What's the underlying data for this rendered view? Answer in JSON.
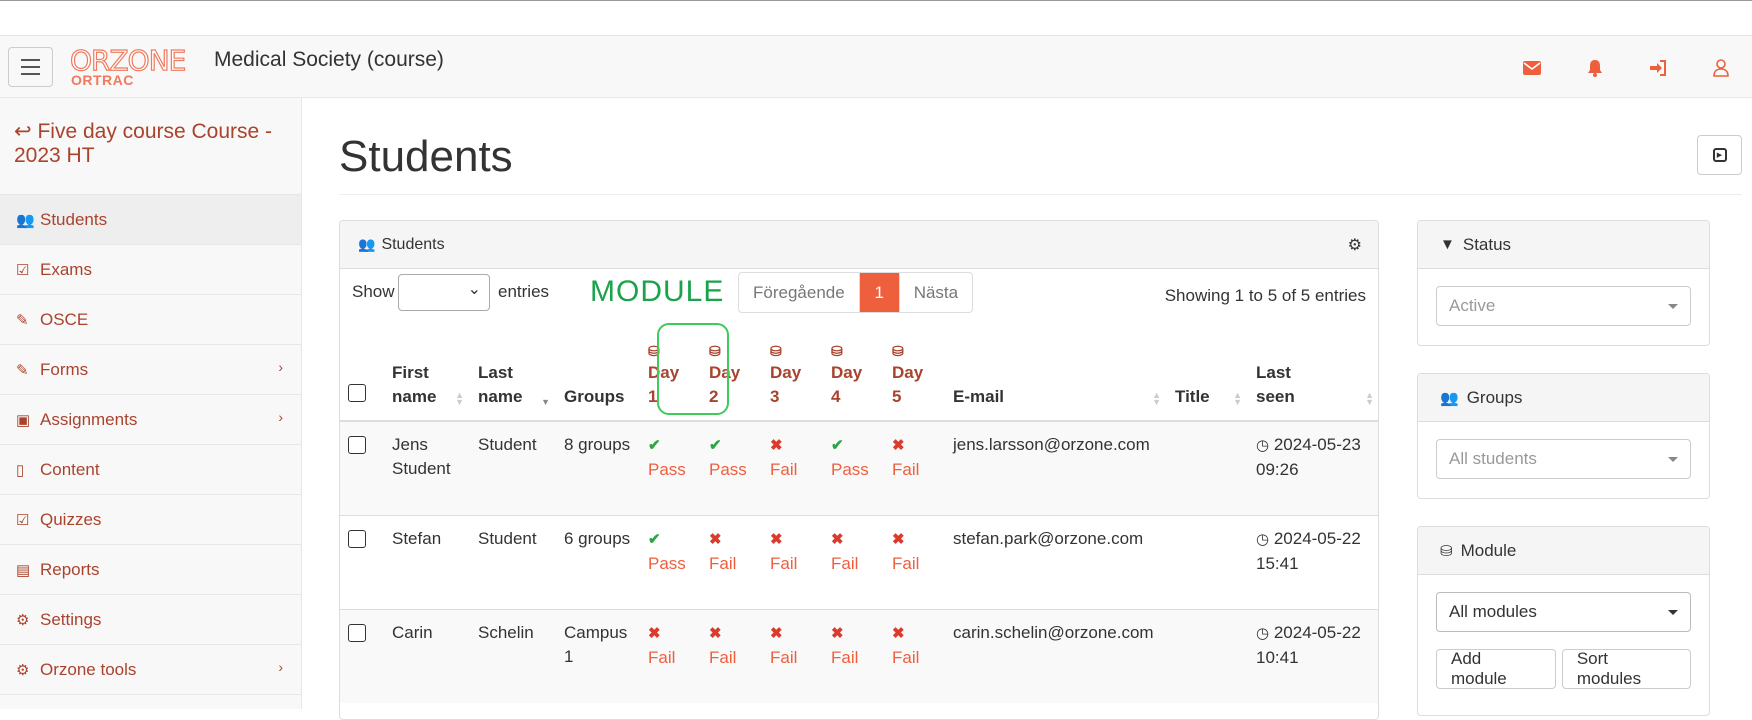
{
  "navbar": {
    "logo_top": "ORZONE",
    "logo_bottom": "ORTRAC",
    "course_title": "Medical Society (course)",
    "icons": [
      "envelope-icon",
      "bell-icon",
      "sign-in-icon",
      "user-icon"
    ]
  },
  "sidebar": {
    "back_label": "Five day course Course - 2023 HT",
    "items": [
      {
        "label": "Students",
        "icon": "users-icon",
        "active": true
      },
      {
        "label": "Exams",
        "icon": "check-square-icon"
      },
      {
        "label": "OSCE",
        "icon": "edit-icon"
      },
      {
        "label": "Forms",
        "icon": "edit-icon",
        "submenu": true
      },
      {
        "label": "Assignments",
        "icon": "word-file-icon",
        "submenu": true
      },
      {
        "label": "Content",
        "icon": "file-icon"
      },
      {
        "label": "Quizzes",
        "icon": "check-square-icon"
      },
      {
        "label": "Reports",
        "icon": "pdf-file-icon"
      },
      {
        "label": "Settings",
        "icon": "cogs-icon"
      },
      {
        "label": "Orzone tools",
        "icon": "cogs-icon",
        "submenu": true
      }
    ]
  },
  "main": {
    "page_title": "Students",
    "panel_title": "Students",
    "show_label": "Show",
    "entries_label": "entries",
    "module_annotation": "MODULE",
    "pager": {
      "prev": "Föregående",
      "current": "1",
      "next": "Nästa"
    },
    "showing_text": "Showing 1 to 5 of 5 entries",
    "columns": {
      "first_name": "First name",
      "last_name": "Last name",
      "groups": "Groups",
      "day1": "Day 1",
      "day2": "Day 2",
      "day3": "Day 3",
      "day4": "Day 4",
      "day5": "Day 5",
      "email": "E-mail",
      "title": "Title",
      "last_seen": "Last seen"
    },
    "rows": [
      {
        "first": "Jens Student",
        "last": "Student",
        "groups": "8 groups",
        "days": [
          "Pass",
          "Pass",
          "Fail",
          "Pass",
          "Fail"
        ],
        "email": "jens.larsson@orzone.com",
        "title": "",
        "last_seen": "2024-05-23 09:26"
      },
      {
        "first": "Stefan",
        "last": "Student",
        "groups": "6 groups",
        "days": [
          "Pass",
          "Fail",
          "Fail",
          "Fail",
          "Fail"
        ],
        "email": "stefan.park@orzone.com",
        "title": "",
        "last_seen": "2024-05-22 15:41"
      },
      {
        "first": "Carin",
        "last": "Schelin",
        "groups": "Campus 1",
        "days": [
          "Fail",
          "Fail",
          "Fail",
          "Fail",
          "Fail"
        ],
        "email": "carin.schelin@orzone.com",
        "title": "",
        "last_seen": "2024-05-22 10:41"
      }
    ]
  },
  "filters": {
    "status": {
      "title": "Status",
      "value": "Active"
    },
    "groups": {
      "title": "Groups",
      "value": "All students"
    },
    "module": {
      "title": "Module",
      "value": "All modules",
      "add_label": "Add module",
      "sort_label": "Sort modules"
    }
  },
  "colors": {
    "accent": "#ee5f3e",
    "link": "#a9432d",
    "pass": "#2aa743",
    "fail": "#dc3b2b",
    "annotation": "#1aa34a"
  }
}
